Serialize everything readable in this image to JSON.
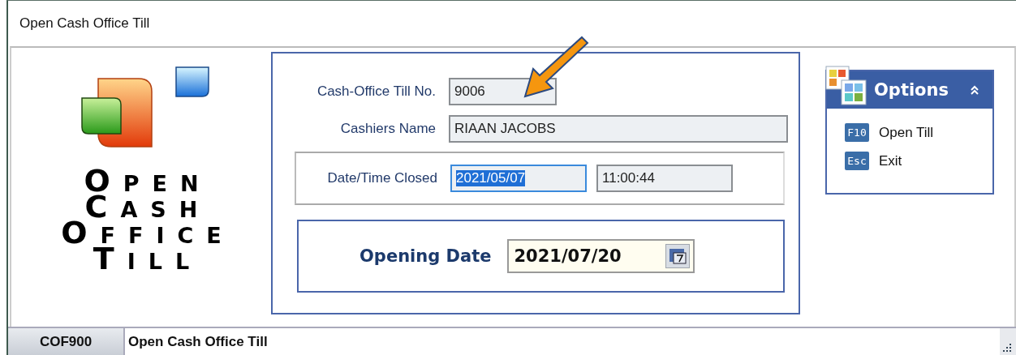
{
  "window": {
    "title": "Open Cash Office Till"
  },
  "logo": {
    "lines": [
      "Open",
      "Cash",
      "Office",
      "Till"
    ]
  },
  "form": {
    "till_no": {
      "label": "Cash-Office Till No.",
      "value": "9006"
    },
    "cashier": {
      "label": "Cashiers Name",
      "value": "RIAAN JACOBS"
    },
    "closed": {
      "label": "Date/Time Closed",
      "date": "2021/05/07",
      "date_selected": true,
      "time": "11:00:44"
    },
    "opening": {
      "label": "Opening Date",
      "value": "2021/07/20"
    }
  },
  "options": {
    "title": "Options",
    "expanded": true,
    "items": [
      {
        "key": "F10",
        "label": "Open Till"
      },
      {
        "key": "Esc",
        "label": "Exit"
      }
    ]
  },
  "status_bar": {
    "code": "COF900",
    "text": "Open Cash Office Till"
  }
}
